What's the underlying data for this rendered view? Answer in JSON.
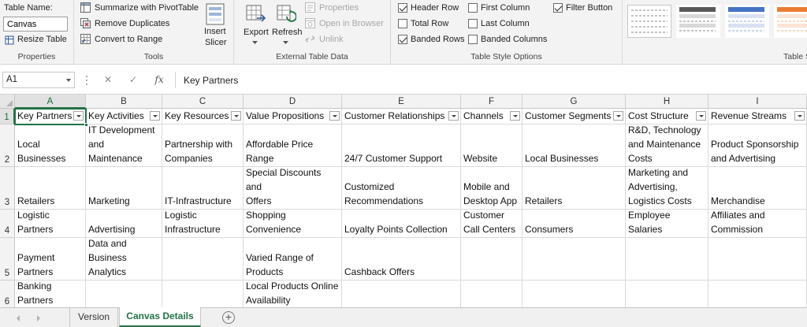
{
  "ribbon": {
    "properties": {
      "table_name_label": "Table Name:",
      "table_name_value": "Canvas",
      "resize_label": "Resize Table",
      "group_label": "Properties"
    },
    "tools": {
      "summarize_label": "Summarize with PivotTable",
      "remove_duplicates_label": "Remove Duplicates",
      "convert_label": "Convert to Range",
      "insert_slicer_line1": "Insert",
      "insert_slicer_line2": "Slicer",
      "group_label": "Tools"
    },
    "external": {
      "export_label": "Export",
      "refresh_label": "Refresh",
      "properties_label": "Properties",
      "open_browser_label": "Open in Browser",
      "unlink_label": "Unlink",
      "group_label": "External Table Data"
    },
    "style_options": {
      "header_row": "Header Row",
      "total_row": "Total Row",
      "banded_rows": "Banded Rows",
      "first_column": "First Column",
      "last_column": "Last Column",
      "banded_columns": "Banded Columns",
      "filter_button": "Filter Button",
      "group_label": "Table Style Options"
    },
    "table_styles": {
      "group_label": "Table S"
    }
  },
  "formula_bar": {
    "name_box": "A1",
    "cancel_symbol": "✕",
    "enter_symbol": "✓",
    "fx_symbol": "fx",
    "formula": "Key Partners"
  },
  "grid": {
    "column_letters": [
      "A",
      "B",
      "C",
      "D",
      "E",
      "F",
      "G",
      "H",
      "I"
    ],
    "row_numbers": [
      "1",
      "2",
      "3",
      "4",
      "5",
      "6"
    ],
    "headers": [
      "Key Partners",
      "Key Activities",
      "Key Resources",
      "Value Propositions",
      "Customer Relationships",
      "Channels",
      "Customer Segments",
      "Cost Structure",
      "Revenue Streams"
    ],
    "rows": [
      [
        "Local\nBusinesses",
        "IT Development\nand\nMaintenance",
        "Partnership with\nCompanies",
        "Affordable Price\nRange",
        "24/7 Customer Support",
        "Website",
        "Local Businesses",
        "R&D, Technology\nand Maintenance\nCosts",
        "Product Sponsorship\nand Advertising"
      ],
      [
        "Retailers",
        "Marketing",
        "IT-Infrastructure",
        "Special Discounts and\nOffers",
        "Customized\nRecommendations",
        "Mobile and\nDesktop App",
        "Retailers",
        "Marketing and\nAdvertising,\nLogistics Costs",
        "Merchandise"
      ],
      [
        "Logistic\nPartners",
        "Advertising",
        "Logistic\nInfrastructure",
        "Shopping\nConvenience",
        "Loyalty Points Collection",
        "Customer\nCall Centers",
        "Consumers",
        "Employee\nSalaries",
        "Affiliates and\nCommission"
      ],
      [
        "Payment\nPartners",
        "Data and\nBusiness\nAnalytics",
        "",
        "Varied Range of\nProducts",
        "Cashback Offers",
        "",
        "",
        "",
        ""
      ],
      [
        "Banking\nPartners",
        "",
        "",
        "Local Products Online\nAvailability",
        "",
        "",
        "",
        "",
        ""
      ]
    ]
  },
  "sheet_tabs": {
    "tabs": [
      "Version",
      "Canvas Details"
    ],
    "active": "Canvas Details",
    "add_symbol": "+"
  },
  "colors": {
    "accent": "#217346",
    "ribbon_bg": "#f3f3f3"
  }
}
